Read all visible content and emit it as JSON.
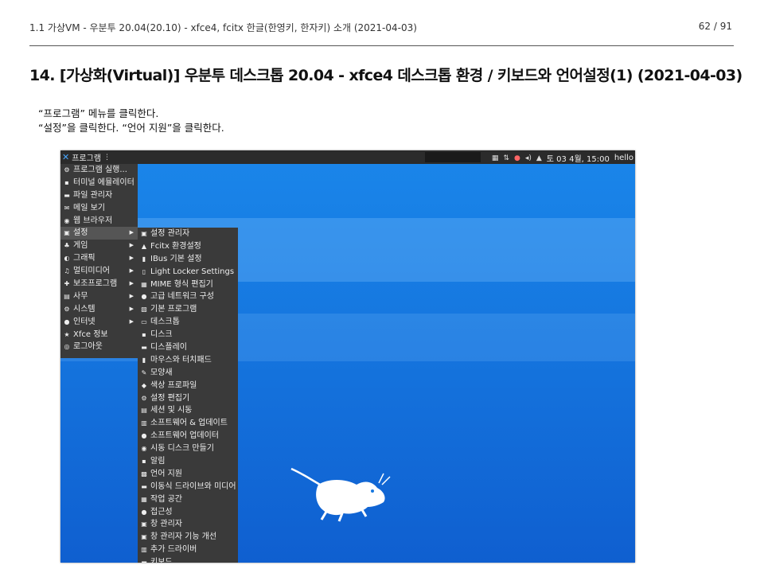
{
  "header": {
    "breadcrumb": "1.1 가상VM - 우분투 20.04(20.10) - xfce4, fcitx 한글(한영키, 한자키) 소개 (2021-04-03)",
    "page": "62 / 91"
  },
  "title": "14. [가상화(Virtual)] 우분투 데스크톱 20.04 - xfce4 데스크톱 환경 / 키보드와 언어설정(1) (2021-04-03)",
  "instructions": [
    "“프로그램” 메뉴를 클릭한다.",
    "“설정”을 클릭한다. “언어 지원”을 클릭한다."
  ],
  "panel": {
    "apps_label": "프로그램",
    "clock": "토 03  4월, 15:00",
    "user": "hello"
  },
  "menu": [
    {
      "label": "프로그램 실행...",
      "icon": "run-icon",
      "glyph": "⚙"
    },
    {
      "label": "터미널 에뮬레이터",
      "icon": "terminal-icon",
      "glyph": "▪"
    },
    {
      "label": "파일 관리자",
      "icon": "folder-icon",
      "glyph": "▬"
    },
    {
      "label": "메일 보기",
      "icon": "mail-icon",
      "glyph": "✉"
    },
    {
      "label": "웹 브라우저",
      "icon": "globe-icon",
      "glyph": "◉"
    },
    {
      "label": "설정",
      "icon": "settings-icon",
      "glyph": "▣",
      "sub": true,
      "selected": true
    },
    {
      "label": "게임",
      "icon": "game-icon",
      "glyph": "♣",
      "sub": true
    },
    {
      "label": "그래픽",
      "icon": "graphics-icon",
      "glyph": "◐",
      "sub": true
    },
    {
      "label": "멀티미디어",
      "icon": "multimedia-icon",
      "glyph": "♫",
      "sub": true
    },
    {
      "label": "보조프로그램",
      "icon": "accessories-icon",
      "glyph": "✚",
      "sub": true
    },
    {
      "label": "사무",
      "icon": "office-icon",
      "glyph": "▤",
      "sub": true
    },
    {
      "label": "시스템",
      "icon": "system-icon",
      "glyph": "⚙",
      "sub": true
    },
    {
      "label": "인터넷",
      "icon": "internet-icon",
      "glyph": "●",
      "sub": true
    },
    {
      "label": "Xfce 정보",
      "icon": "star-icon",
      "glyph": "★"
    },
    {
      "label": "로그아웃",
      "icon": "logout-icon",
      "glyph": "◎"
    }
  ],
  "submenu": [
    {
      "label": "설정 관리자",
      "icon": "settings-manager-icon",
      "glyph": "▣"
    },
    {
      "label": "Fcitx 환경설정",
      "icon": "fcitx-icon",
      "glyph": "▲"
    },
    {
      "label": "IBus 기본 설정",
      "icon": "ibus-icon",
      "glyph": "▮"
    },
    {
      "label": "Light Locker Settings",
      "icon": "lock-icon",
      "glyph": "▯"
    },
    {
      "label": "MIME 형식 편집기",
      "icon": "mime-icon",
      "glyph": "▦"
    },
    {
      "label": "고급 네트워크 구성",
      "icon": "network-icon",
      "glyph": "●"
    },
    {
      "label": "기본 프로그램",
      "icon": "default-apps-icon",
      "glyph": "▧"
    },
    {
      "label": "데스크톱",
      "icon": "desktop-icon",
      "glyph": "▭"
    },
    {
      "label": "디스크",
      "icon": "disk-icon",
      "glyph": "▪"
    },
    {
      "label": "디스플레이",
      "icon": "display-icon",
      "glyph": "▬"
    },
    {
      "label": "마우스와 터치패드",
      "icon": "mouse-icon",
      "glyph": "▮"
    },
    {
      "label": "모양새",
      "icon": "appearance-icon",
      "glyph": "✎"
    },
    {
      "label": "색상 프로파일",
      "icon": "color-profile-icon",
      "glyph": "◆"
    },
    {
      "label": "설정 편집기",
      "icon": "settings-editor-icon",
      "glyph": "⚙"
    },
    {
      "label": "세션 및 시동",
      "icon": "session-icon",
      "glyph": "▤"
    },
    {
      "label": "소프트웨어 & 업데이트",
      "icon": "software-icon",
      "glyph": "▥"
    },
    {
      "label": "소프트웨어 업데이터",
      "icon": "updater-icon",
      "glyph": "●"
    },
    {
      "label": "시동 디스크 만들기",
      "icon": "startup-disk-icon",
      "glyph": "◉"
    },
    {
      "label": "알림",
      "icon": "notification-icon",
      "glyph": "▪"
    },
    {
      "label": "언어 지원",
      "icon": "language-icon",
      "glyph": "▩"
    },
    {
      "label": "이동식 드라이브와 미디어",
      "icon": "removable-drive-icon",
      "glyph": "▬"
    },
    {
      "label": "작업 공간",
      "icon": "workspace-icon",
      "glyph": "▦"
    },
    {
      "label": "접근성",
      "icon": "accessibility-icon",
      "glyph": "●"
    },
    {
      "label": "창 관리자",
      "icon": "window-manager-icon",
      "glyph": "▣"
    },
    {
      "label": "창 관리자 기능 개선",
      "icon": "window-tweaks-icon",
      "glyph": "▣"
    },
    {
      "label": "추가 드라이버",
      "icon": "driver-icon",
      "glyph": "▥"
    },
    {
      "label": "키보드",
      "icon": "keyboard-icon",
      "glyph": "▬"
    }
  ]
}
